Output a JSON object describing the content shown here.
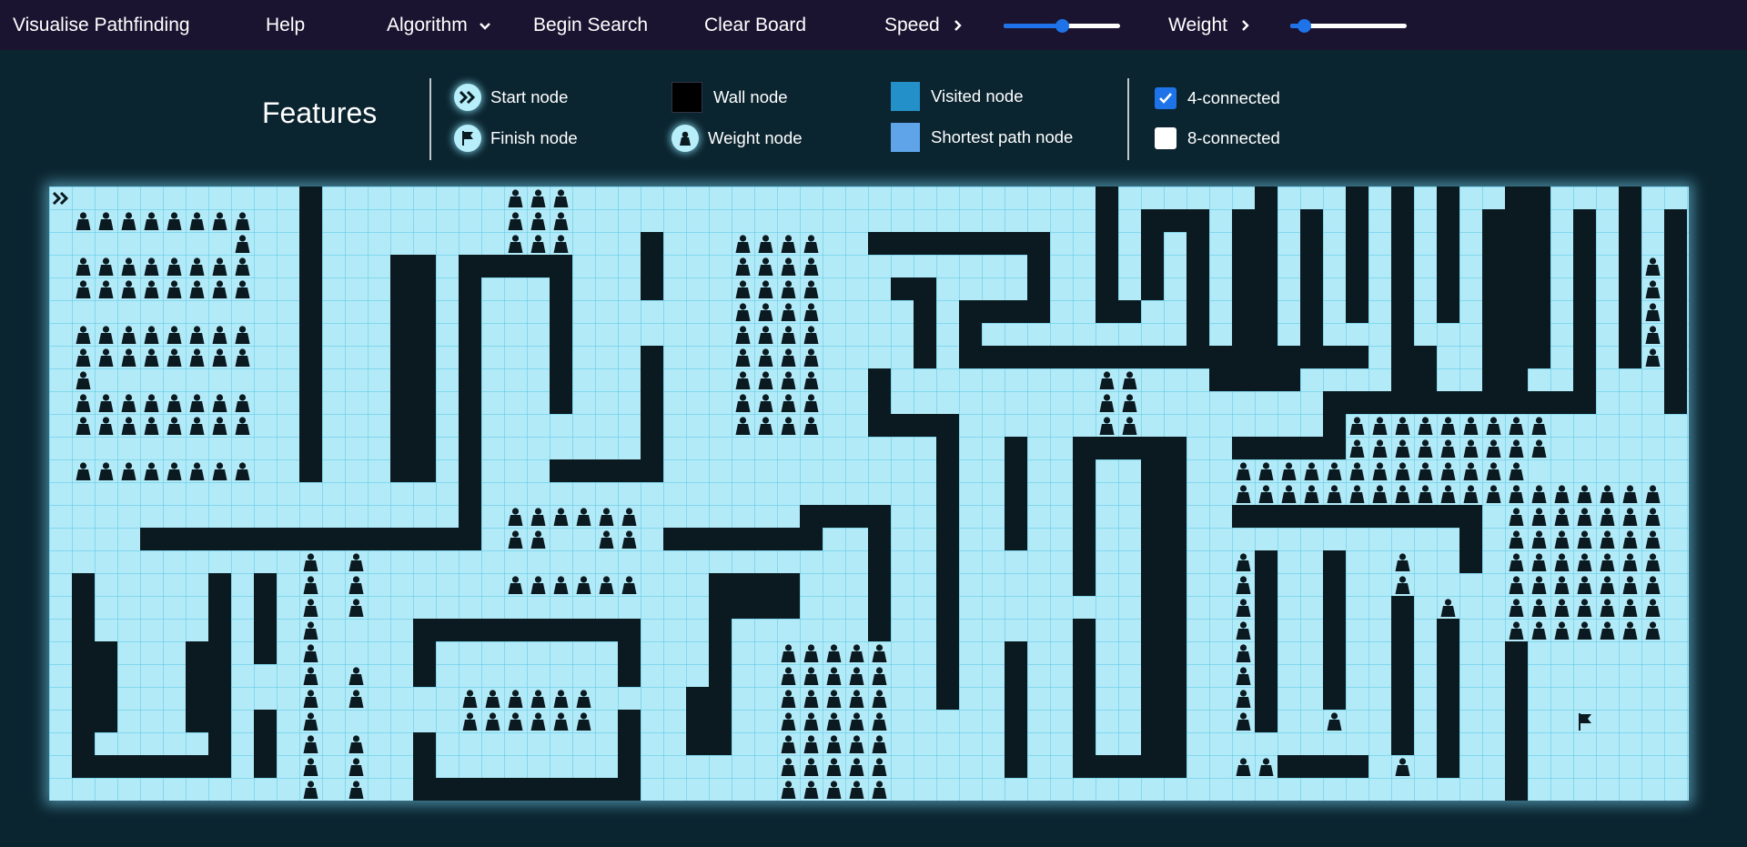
{
  "navbar": {
    "brand": "Visualise Pathfinding",
    "help": "Help",
    "algorithm": "Algorithm",
    "begin_search": "Begin Search",
    "clear_board": "Clear Board",
    "speed": "Speed",
    "speed_level": 0.5,
    "weight": "Weight",
    "weight_level": 0.12
  },
  "legend": {
    "title": "Features",
    "start_node": "Start node",
    "finish_node": "Finish node",
    "wall_node": "Wall node",
    "weight_node": "Weight node",
    "visited_node": "Visited node",
    "shortest_path_node": "Shortest path node",
    "four_connected": "4-connected",
    "eight_connected": "8-connected",
    "four_connected_checked": true,
    "eight_connected_checked": false
  },
  "colors": {
    "navbar": "#1a1430",
    "background": "#0b2530",
    "grid_cell": "#b3eaf8",
    "wall": "#0a1a20",
    "visited": "#2390c9",
    "shortest_path": "#5fa4e8",
    "accent": "#1e73e8"
  },
  "icons": {
    "start": "double-chevron-right-icon",
    "finish": "flag-icon",
    "weight": "kettlebell-weight-icon",
    "dropdown": "chevron-down-icon",
    "expand": "chevron-right-icon"
  }
}
